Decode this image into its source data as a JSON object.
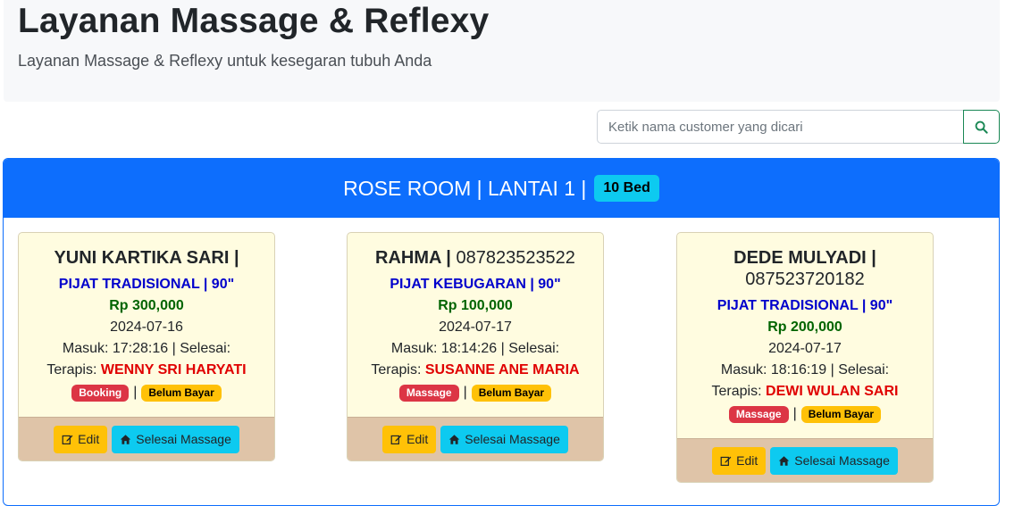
{
  "header": {
    "title": "Layanan Massage & Reflexy",
    "subtitle": "Layanan Massage & Reflexy untuk kesegaran tubuh Anda"
  },
  "search": {
    "placeholder": "Ketik nama customer yang dicari",
    "button_icon": "search-icon"
  },
  "room": {
    "title": "ROSE ROOM | LANTAI 1 |",
    "bed_badge": "10 Bed"
  },
  "cards": [
    {
      "name": "YUNI KARTIKA SARI |",
      "phone": "",
      "service": "PIJAT TRADISIONAL | 90\"",
      "price": "Rp 300,000",
      "date": "2024-07-16",
      "time": "Masuk: 17:28:16 | Selesai:",
      "therapist_label": "Terapis:",
      "therapist": "WENNY SRI HARYATI",
      "status": "Booking",
      "payment": "Belum Bayar",
      "edit_label": "Edit",
      "finish_label": "Selesai Massage"
    },
    {
      "name": "RAHMA |",
      "phone": "087823523522",
      "service": "PIJAT KEBUGARAN | 90\"",
      "price": "Rp 100,000",
      "date": "2024-07-17",
      "time": "Masuk: 18:14:26 | Selesai:",
      "therapist_label": "Terapis:",
      "therapist": "SUSANNE ANE MARIA",
      "status": "Massage",
      "payment": "Belum Bayar",
      "edit_label": "Edit",
      "finish_label": "Selesai Massage"
    },
    {
      "name": "DEDE MULYADI |",
      "phone": "087523720182",
      "service": "PIJAT TRADISIONAL | 90\"",
      "price": "Rp 200,000",
      "date": "2024-07-17",
      "time": "Masuk: 18:16:19 | Selesai:",
      "therapist_label": "Terapis:",
      "therapist": "DEWI WULAN SARI",
      "status": "Massage",
      "payment": "Belum Bayar",
      "edit_label": "Edit",
      "finish_label": "Selesai Massage"
    }
  ],
  "separator": "|",
  "colors": {
    "primary": "#0d6efd",
    "info": "#0dcaf0",
    "warning": "#ffc107",
    "danger": "#dc3545",
    "service_text": "#0000cc",
    "price_text": "#006400",
    "therapist_text": "#e00000",
    "card_bg": "#fffce0",
    "card_footer_bg": "#dfc4a8"
  }
}
